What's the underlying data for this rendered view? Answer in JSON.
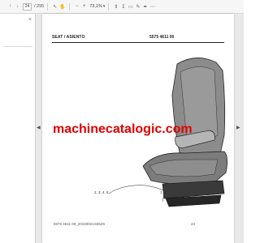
{
  "toolbar": {
    "current_page": "24",
    "total_pages": "/ 295",
    "zoom": "73,1%"
  },
  "document": {
    "header_title": "SEAT / ASIENTO",
    "part_number": "5575 4611 00",
    "watermark": "machinecatalogic.com",
    "callout_left": "2, 3, 4, 5",
    "callout_right": "1",
    "footer_code": "5575 4611 00_20150021S65Z6",
    "footer_page": "24"
  },
  "icons": {
    "up": "arrow-up-icon",
    "down": "arrow-down-icon",
    "zoom_out": "minus-icon",
    "zoom_in": "plus-icon",
    "select": "cursor-icon",
    "download": "download-icon",
    "comment": "comment-icon",
    "sign": "pen-icon",
    "more": "more-icon"
  }
}
